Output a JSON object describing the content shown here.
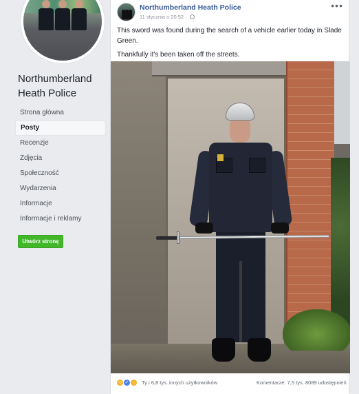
{
  "page": {
    "name": "Northumberland Heath Police"
  },
  "nav": {
    "items": [
      {
        "label": "Strona główna"
      },
      {
        "label": "Posty"
      },
      {
        "label": "Recenzje"
      },
      {
        "label": "Zdjęcia"
      },
      {
        "label": "Społeczność"
      },
      {
        "label": "Wydarzenia"
      },
      {
        "label": "Informacje"
      },
      {
        "label": "Informacje i reklamy"
      }
    ],
    "active_index": 1,
    "create_page_label": "Utwórz stronę"
  },
  "post": {
    "author": "Northumberland Heath Police",
    "time": "11 stycznia o 20:52",
    "more_label": "•••",
    "text_line_1": "This sword was found during the search of a vehicle earlier today in Slade Green.",
    "text_line_2": "Thankfully it's been taken off the streets."
  },
  "footer": {
    "reactions_text": "Ty i 6,8 tys. innych użytkowników",
    "comments": "Komentarze: 7,5 tys.",
    "shares": "8089 udostępnień",
    "reaction_icons": [
      "haha-icon",
      "like-icon",
      "wow-icon"
    ]
  },
  "colors": {
    "link": "#365899",
    "create_button": "#42b72a",
    "background": "#e9ebee"
  }
}
